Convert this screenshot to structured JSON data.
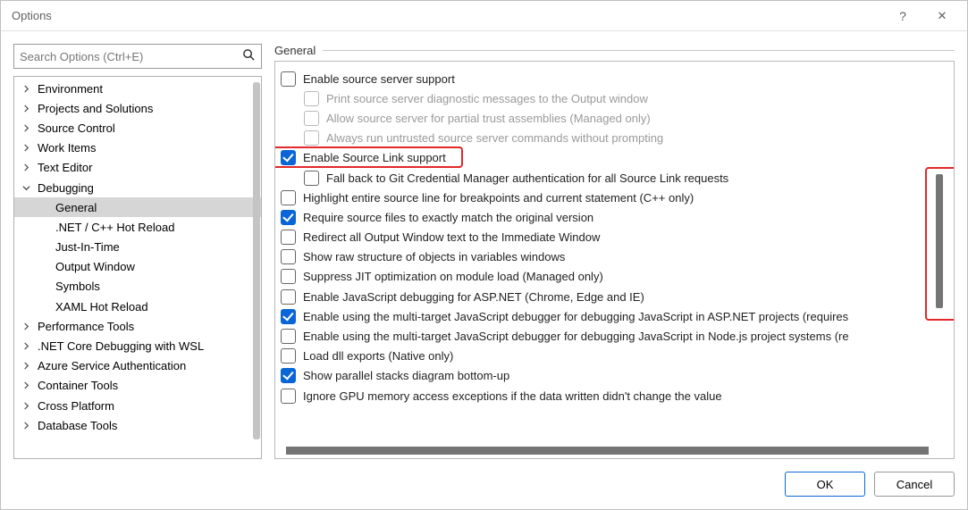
{
  "window": {
    "title": "Options"
  },
  "search": {
    "placeholder": "Search Options (Ctrl+E)"
  },
  "tree": [
    {
      "label": "Environment",
      "expanded": false,
      "type": "node"
    },
    {
      "label": "Projects and Solutions",
      "expanded": false,
      "type": "node"
    },
    {
      "label": "Source Control",
      "expanded": false,
      "type": "node"
    },
    {
      "label": "Work Items",
      "expanded": false,
      "type": "node"
    },
    {
      "label": "Text Editor",
      "expanded": false,
      "type": "node"
    },
    {
      "label": "Debugging",
      "expanded": true,
      "type": "node"
    },
    {
      "label": "General",
      "type": "child",
      "selected": true
    },
    {
      "label": ".NET / C++ Hot Reload",
      "type": "child"
    },
    {
      "label": "Just-In-Time",
      "type": "child"
    },
    {
      "label": "Output Window",
      "type": "child"
    },
    {
      "label": "Symbols",
      "type": "child"
    },
    {
      "label": "XAML Hot Reload",
      "type": "child"
    },
    {
      "label": "Performance Tools",
      "expanded": false,
      "type": "node"
    },
    {
      "label": ".NET Core Debugging with WSL",
      "expanded": false,
      "type": "node"
    },
    {
      "label": "Azure Service Authentication",
      "expanded": false,
      "type": "node"
    },
    {
      "label": "Container Tools",
      "expanded": false,
      "type": "node"
    },
    {
      "label": "Cross Platform",
      "expanded": false,
      "type": "node"
    },
    {
      "label": "Database Tools",
      "expanded": false,
      "type": "node"
    }
  ],
  "panel": {
    "group_title": "General",
    "options": [
      {
        "label": "Enable source server support",
        "checked": false,
        "indent": 1,
        "disabled": false
      },
      {
        "label": "Print source server diagnostic messages to the Output window",
        "checked": false,
        "indent": 2,
        "disabled": true
      },
      {
        "label": "Allow source server for partial trust assemblies (Managed only)",
        "checked": false,
        "indent": 2,
        "disabled": true
      },
      {
        "label": "Always run untrusted source server commands without prompting",
        "checked": false,
        "indent": 2,
        "disabled": true
      },
      {
        "label": "Enable Source Link support",
        "checked": true,
        "indent": 1,
        "disabled": false,
        "highlight": true
      },
      {
        "label": "Fall back to Git Credential Manager authentication for all Source Link requests",
        "checked": false,
        "indent": 2,
        "disabled": false
      },
      {
        "label": "Highlight entire source line for breakpoints and current statement (C++ only)",
        "checked": false,
        "indent": 1,
        "disabled": false
      },
      {
        "label": "Require source files to exactly match the original version",
        "checked": true,
        "indent": 1,
        "disabled": false
      },
      {
        "label": "Redirect all Output Window text to the Immediate Window",
        "checked": false,
        "indent": 1,
        "disabled": false
      },
      {
        "label": "Show raw structure of objects in variables windows",
        "checked": false,
        "indent": 1,
        "disabled": false
      },
      {
        "label": "Suppress JIT optimization on module load (Managed only)",
        "checked": false,
        "indent": 1,
        "disabled": false
      },
      {
        "label": "Enable JavaScript debugging for ASP.NET (Chrome, Edge and IE)",
        "checked": false,
        "indent": 1,
        "disabled": false
      },
      {
        "label": "Enable using the multi-target JavaScript debugger for debugging JavaScript in ASP.NET projects (requires",
        "checked": true,
        "indent": 1,
        "disabled": false
      },
      {
        "label": "Enable using the multi-target JavaScript debugger for debugging JavaScript in Node.js project systems (re",
        "checked": false,
        "indent": 1,
        "disabled": false
      },
      {
        "label": "Load dll exports (Native only)",
        "checked": false,
        "indent": 1,
        "disabled": false
      },
      {
        "label": "Show parallel stacks diagram bottom-up",
        "checked": true,
        "indent": 1,
        "disabled": false
      },
      {
        "label": "Ignore GPU memory access exceptions if the data written didn't change the value",
        "checked": false,
        "indent": 1,
        "disabled": false
      }
    ]
  },
  "buttons": {
    "ok": "OK",
    "cancel": "Cancel"
  }
}
